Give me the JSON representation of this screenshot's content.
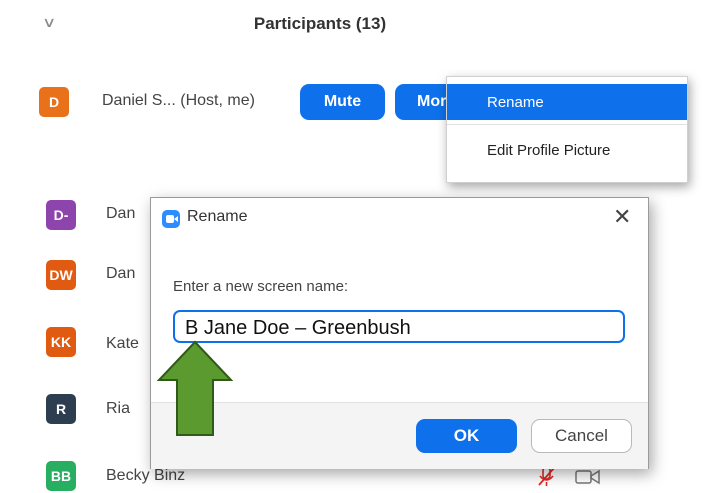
{
  "panel": {
    "title": "Participants (13)",
    "collapse_icon": "chevron-down-icon"
  },
  "host": {
    "initial": "D",
    "name": "Daniel S... (Host, me)",
    "mute_label": "Mute",
    "more_label": "Mor",
    "avatar_color": "#e8711a"
  },
  "context_menu": {
    "items": [
      {
        "label": "Rename",
        "active": true
      },
      {
        "label": "Edit Profile Picture",
        "active": false
      }
    ]
  },
  "participants": [
    {
      "initials": "D-",
      "name": "Dan",
      "color": "#8e44ad"
    },
    {
      "initials": "DW",
      "name": "Dan",
      "color": "#e05a12"
    },
    {
      "initials": "KK",
      "name": "Kate",
      "color": "#e05a12"
    },
    {
      "initials": "R",
      "name": "Ria",
      "color": "#2c3e50"
    },
    {
      "initials": "BB",
      "name": "Becky Binz",
      "color": "#27ae60"
    }
  ],
  "dialog": {
    "title": "Rename",
    "label": "Enter a new screen name:",
    "value": "B Jane Doe – Greenbush",
    "ok_label": "OK",
    "cancel_label": "Cancel"
  },
  "colors": {
    "accent": "#0e71eb",
    "arrow_fill": "#5a9a2e",
    "arrow_stroke": "#2f5a17"
  }
}
